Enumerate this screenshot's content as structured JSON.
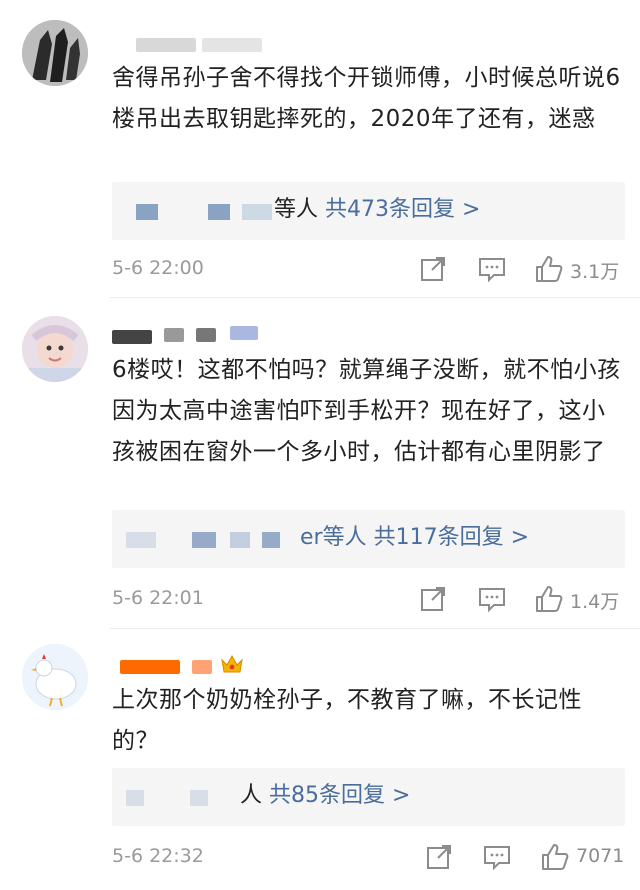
{
  "comments": [
    {
      "text": "舍得吊孙子舍不得找个开锁师傅，小时候总听说6楼吊出去取钥匙摔死的，2020年了还有，迷惑",
      "reply_names": "等人",
      "reply_link": "共473条回复 >",
      "time": "5-6 22:00",
      "likes": "3.1万"
    },
    {
      "text": "6楼哎！这都不怕吗？就算绳子没断，就不怕小孩因为太高中途害怕吓到手松开？现在好了，这小孩被困在窗外一个多小时，估计都有心里阴影了",
      "reply_names": "er等人",
      "reply_link": "共117条回复 >",
      "time": "5-6 22:01",
      "likes": "1.4万"
    },
    {
      "text": "上次那个奶奶栓孙子，不教育了嘛，不长记性的？",
      "reply_names": "人",
      "reply_link": "共85条回复 >",
      "time": "5-6 22:32",
      "likes": "7071"
    }
  ],
  "icons": [
    "share-icon",
    "comment-icon",
    "like-icon",
    "avatar",
    "crown-icon"
  ],
  "colors": {
    "link": "#4a6d9c",
    "timestamp": "#9a9a9a",
    "reply_bg": "#f5f5f5"
  }
}
